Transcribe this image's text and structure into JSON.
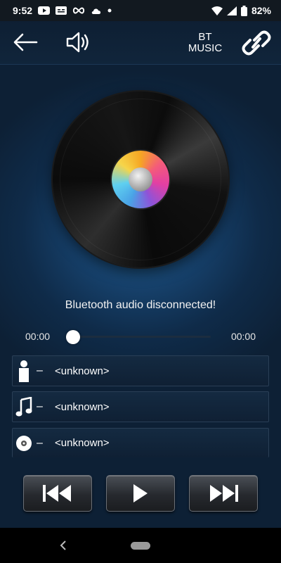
{
  "status_bar": {
    "time": "9:52",
    "battery_percent": "82%",
    "icons": [
      "youtube-icon",
      "caption-icon",
      "infinity-icon",
      "cloud-icon",
      "dot-icon",
      "wifi-icon",
      "signal-icon",
      "battery-icon"
    ]
  },
  "topbar": {
    "back_icon": "arrow-left-icon",
    "volume_icon": "speaker-icon",
    "source_line1": "BT",
    "source_line2": "MUSIC",
    "link_icon": "chain-link-icon"
  },
  "player": {
    "message": "Bluetooth audio disconnected!",
    "elapsed": "00:00",
    "duration": "00:00",
    "progress_fraction": 0
  },
  "track_info": {
    "artist_icon": "person-icon",
    "artist": "<unknown>",
    "title_icon": "music-note-icon",
    "title": "<unknown>",
    "album_icon": "disc-icon",
    "album": "<unknown>",
    "separator": "–"
  },
  "controls": {
    "prev_icon": "skip-previous-icon",
    "play_icon": "play-icon",
    "next_icon": "skip-next-icon"
  },
  "colors": {
    "background": "#0f2b49",
    "accent": "#1f5a88"
  }
}
